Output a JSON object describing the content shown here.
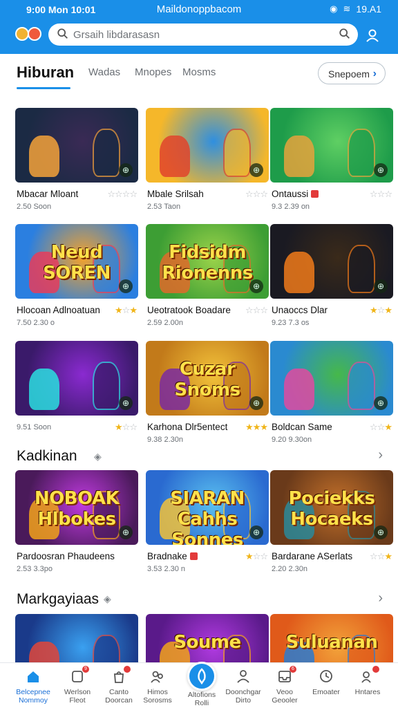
{
  "status_bar": {
    "left": "9:00 Mon 10:01",
    "center": "Maildonoppbacom",
    "right": "19.A1"
  },
  "header": {
    "search_placeholder": "Grsaih libdarasasn"
  },
  "tabs": [
    {
      "label": "Hiburan",
      "active": true
    },
    {
      "label": "Wadas",
      "active": false
    },
    {
      "label": "Mnopes",
      "active": false
    },
    {
      "label": "Mosms",
      "active": false
    }
  ],
  "sort_button": {
    "label": "Snepoem"
  },
  "grid1": [
    {
      "name": "Mbacar Mloant",
      "meta": "2.50 Soon",
      "stars": [
        0,
        0,
        0,
        0
      ],
      "theme": "dark-hero"
    },
    {
      "name": "Mbale Srilsah",
      "meta": "2.53 Taon",
      "stars": [
        0,
        0,
        0
      ],
      "theme": "yellow-puzzle"
    },
    {
      "name": "Ontaussi",
      "meta": "9.3 2.39 on",
      "stars": [
        0,
        0,
        0
      ],
      "tag": true,
      "theme": "green-wolf"
    },
    {
      "name": "Hlocoan Adlnoatuan",
      "meta": "7.50 2.30 o",
      "stars": [
        1,
        0,
        1
      ],
      "theme": "blue-soren",
      "thumb_title": "Neud SOREN"
    },
    {
      "name": "Ueotratook Boadare",
      "meta": "2.59 2.00n",
      "stars": [
        0,
        0,
        0
      ],
      "theme": "green-fox",
      "thumb_title": "Fidsidm Rionenns"
    },
    {
      "name": "Unaoccs Dlar",
      "meta": "9.23 7.3 os",
      "stars": [
        1,
        0,
        1
      ],
      "theme": "dark-battle"
    },
    {
      "name": "9.51 Soon",
      "meta": "",
      "stars": [
        1,
        0,
        0
      ],
      "theme": "purple-dance",
      "name_is_meta": true
    },
    {
      "name": "Karhona Dlr5entect",
      "meta": "9.38 2.30n",
      "stars": [
        1,
        1,
        1
      ],
      "theme": "gold-shrine",
      "thumb_title": "Cuzar Snoms"
    },
    {
      "name": "Boldcan Same",
      "meta": "9.20 9.30on",
      "stars": [
        0,
        0,
        1
      ],
      "theme": "green-field"
    }
  ],
  "section2": {
    "title": "Kadkinan"
  },
  "grid2": [
    {
      "name": "Pardoosran Phaudeens",
      "meta": "2.53 3.3po",
      "stars": [],
      "theme": "purple-noboak",
      "thumb_title": "NOBOAK Hlbokes"
    },
    {
      "name": "Bradnake",
      "meta": "3.53 2.30 n",
      "stars": [
        1,
        0,
        0
      ],
      "tag": true,
      "theme": "blue-sonnes",
      "thumb_title": "SIARAN Cahhs Sonnes"
    },
    {
      "name": "Bardarane ASerlats",
      "meta": "2.20 2.30n",
      "stars": [
        0,
        0,
        1
      ],
      "theme": "brown-cards",
      "thumb_title": "Pociekks Hocaeks"
    }
  ],
  "section3": {
    "title": "Markgayiaas"
  },
  "grid3": [
    {
      "theme": "blue-arcade"
    },
    {
      "theme": "purple-soume",
      "thumb_title": "Soume"
    },
    {
      "theme": "orange-family",
      "thumb_title": "Suluanan"
    }
  ],
  "bottom_nav": [
    {
      "l1": "Belcepnee",
      "l2": "Nommoy",
      "icon": "home-icon",
      "active": true
    },
    {
      "l1": "Werlson",
      "l2": "Fleot",
      "icon": "shield-icon",
      "dot": "9"
    },
    {
      "l1": "Canto",
      "l2": "Doorcan",
      "icon": "bag-icon",
      "dot": ""
    },
    {
      "l1": "Himos",
      "l2": "Sorosms",
      "icon": "people-icon"
    },
    {
      "l1": "Altofions",
      "l2": "Rolli",
      "icon": "center-icon",
      "center": true
    },
    {
      "l1": "Doonchgar",
      "l2": "Dirto",
      "icon": "person-icon"
    },
    {
      "l1": "Veoo",
      "l2": "Geooler",
      "icon": "inbox-icon",
      "dot": "6"
    },
    {
      "l1": "Emoater",
      "l2": "",
      "icon": "clock-icon"
    },
    {
      "l1": "Hntares",
      "l2": "",
      "icon": "flag-icon",
      "dot": ""
    }
  ]
}
